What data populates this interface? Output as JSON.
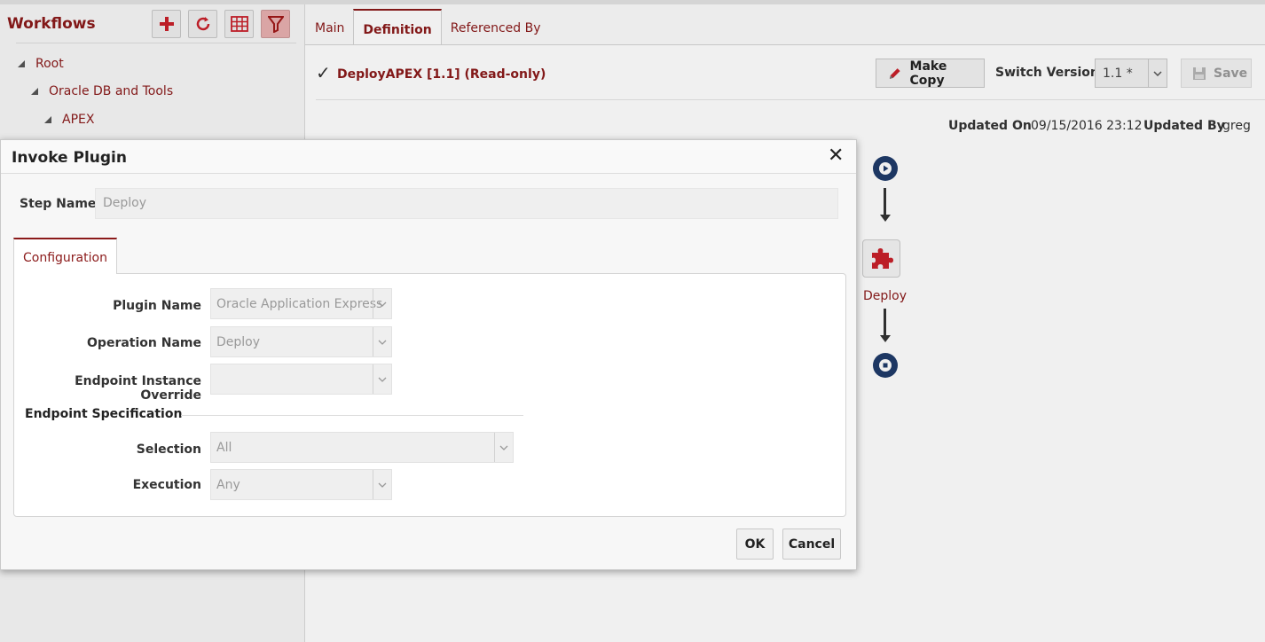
{
  "left_panel": {
    "title": "Workflows",
    "toolbar": {
      "add": "add-icon",
      "refresh": "refresh-icon",
      "grid": "grid-icon",
      "filter": "filter-icon"
    },
    "tree": [
      {
        "label": "Root",
        "level": 0
      },
      {
        "label": "Oracle DB and Tools",
        "level": 1
      },
      {
        "label": "APEX",
        "level": 2
      }
    ]
  },
  "tabs": [
    {
      "label": "Main"
    },
    {
      "label": "Definition"
    },
    {
      "label": "Referenced By"
    }
  ],
  "workflow": {
    "title": "DeployAPEX [1.1] (Read-only)",
    "make_copy_label": "Make Copy",
    "switch_version_label": "Switch Version",
    "version_value": "1.1 *",
    "save_label": "Save",
    "updated_on_label": "Updated On",
    "updated_on_value": "09/15/2016 23:12",
    "updated_by_label": "Updated By",
    "updated_by_value": "greg",
    "step_label": "Deploy"
  },
  "modal": {
    "title": "Invoke Plugin",
    "step_name_label": "Step Name",
    "step_name_value": "Deploy",
    "tab_label": "Configuration",
    "plugin_name_label": "Plugin Name",
    "plugin_name_value": "Oracle Application Express",
    "operation_name_label": "Operation Name",
    "operation_name_value": "Deploy",
    "endpoint_override_label": "Endpoint Instance Override",
    "endpoint_override_value": "",
    "endpoint_spec_heading": "Endpoint Specification",
    "selection_label": "Selection",
    "selection_value": "All",
    "execution_label": "Execution",
    "execution_value": "Any",
    "ok_label": "OK",
    "cancel_label": "Cancel"
  },
  "colors": {
    "accent": "#8b1a1a",
    "node_blue": "#1f3b6a",
    "plugin_red": "#c8202a"
  }
}
